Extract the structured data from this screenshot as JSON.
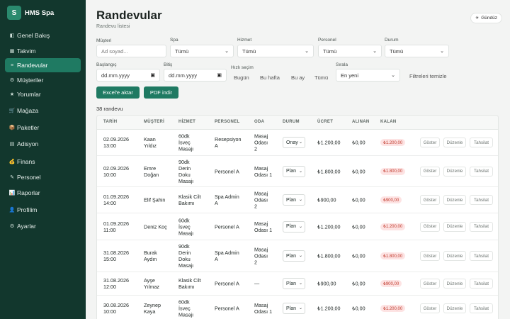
{
  "brand": {
    "logo_letter": "S",
    "name": "HMS Spa"
  },
  "sidebar": {
    "items": [
      {
        "label": "Genel Bakış",
        "icon": "dashboard-icon",
        "glyph": "◧"
      },
      {
        "label": "Takvim",
        "icon": "calendar-icon",
        "glyph": "▦"
      },
      {
        "label": "Randevular",
        "icon": "list-icon",
        "glyph": "≡",
        "active": true
      },
      {
        "label": "Müşteriler",
        "icon": "customers-icon",
        "glyph": "⚙"
      },
      {
        "label": "Yorumlar",
        "icon": "star-icon",
        "glyph": "★"
      },
      {
        "label": "Mağaza",
        "icon": "cart-icon",
        "glyph": "🛒"
      },
      {
        "label": "Paketler",
        "icon": "package-icon",
        "glyph": "📦"
      },
      {
        "label": "Adisyon",
        "icon": "receipt-icon",
        "glyph": "▤"
      },
      {
        "label": "Finans",
        "icon": "money-icon",
        "glyph": "💰"
      },
      {
        "label": "Personel",
        "icon": "staff-icon",
        "glyph": "✎"
      },
      {
        "label": "Raporlar",
        "icon": "chart-icon",
        "glyph": "📊"
      },
      {
        "label": "Profilim",
        "icon": "profile-icon",
        "glyph": "👤"
      },
      {
        "label": "Ayarlar",
        "icon": "settings-icon",
        "glyph": "⚙"
      }
    ]
  },
  "header": {
    "title": "Randevular",
    "subtitle": "Randevu listesi",
    "theme_label": "Gündüz",
    "theme_glyph": "☀"
  },
  "filters": {
    "customer_label": "Müşteri",
    "customer_placeholder": "Ad soyad...",
    "spa_label": "Spa",
    "spa_value": "Tümü",
    "service_label": "Hizmet",
    "service_value": "Tümü",
    "staff_label": "Personel",
    "staff_value": "Tümü",
    "status_label": "Durum",
    "status_value": "Tümü",
    "start_label": "Başlangıç",
    "start_placeholder": "dd.mm.yyyy",
    "end_label": "Bitiş",
    "end_placeholder": "dd.mm.yyyy",
    "quick_label": "Hızlı seçim",
    "quick_options": [
      "Bugün",
      "Bu hafta",
      "Bu ay",
      "Tümü"
    ],
    "sort_label": "Sırala",
    "sort_value": "En yeni",
    "clear_label": "Filtreleri temizle"
  },
  "actions": {
    "excel_label": "Excel'e aktar",
    "pdf_label": "PDF indir"
  },
  "count_text": "38 randevu",
  "table": {
    "columns": [
      "TARİH",
      "MÜŞTERİ",
      "HİZMET",
      "PERSONEL",
      "ODA",
      "DURUM",
      "ÜCRET",
      "ALINAN",
      "KALAN"
    ],
    "action_labels": {
      "show": "Göster",
      "edit": "Düzenle",
      "collect": "Tahsilat"
    },
    "rows": [
      {
        "date": [
          "02.09.2026",
          "13:00"
        ],
        "customer": [
          "Kaan",
          "Yıldız"
        ],
        "service": [
          "60dk",
          "İsveç",
          "Masajı"
        ],
        "staff": [
          "Resepsiyon",
          "A"
        ],
        "room": [
          "Masaj",
          "Odası",
          "2"
        ],
        "status": "Onay",
        "fee": "₺1.200,00",
        "paid": "₺0,00",
        "remaining": "₺1.200,00"
      },
      {
        "date": [
          "02.09.2026",
          "10:00"
        ],
        "customer": [
          "Emre",
          "Doğan"
        ],
        "service": [
          "90dk",
          "Derin",
          "Doku",
          "Masajı"
        ],
        "staff": [
          "Personel A"
        ],
        "room": [
          "Masaj",
          "Odası 1"
        ],
        "status": "Plan",
        "fee": "₺1.800,00",
        "paid": "₺0,00",
        "remaining": "₺1.800,00"
      },
      {
        "date": [
          "01.09.2026",
          "14:00"
        ],
        "customer": [
          "Elif Şahin"
        ],
        "service": [
          "Klasik Cilt",
          "Bakımı"
        ],
        "staff": [
          "Spa Admin",
          "A"
        ],
        "room": [
          "Masaj",
          "Odası",
          "2"
        ],
        "status": "Plan",
        "fee": "₺900,00",
        "paid": "₺0,00",
        "remaining": "₺900,00"
      },
      {
        "date": [
          "01.09.2026",
          "11:00"
        ],
        "customer": [
          "Deniz Koç"
        ],
        "service": [
          "60dk",
          "İsveç",
          "Masajı"
        ],
        "staff": [
          "Personel A"
        ],
        "room": [
          "Masaj",
          "Odası 1"
        ],
        "status": "Plan",
        "fee": "₺1.200,00",
        "paid": "₺0,00",
        "remaining": "₺1.200,00"
      },
      {
        "date": [
          "31.08.2026",
          "15:00"
        ],
        "customer": [
          "Burak",
          "Aydın"
        ],
        "service": [
          "90dk",
          "Derin",
          "Doku",
          "Masajı"
        ],
        "staff": [
          "Spa Admin",
          "A"
        ],
        "room": [
          "Masaj",
          "Odası",
          "2"
        ],
        "status": "Plan",
        "fee": "₺1.800,00",
        "paid": "₺0,00",
        "remaining": "₺1.800,00"
      },
      {
        "date": [
          "31.08.2026",
          "12:00"
        ],
        "customer": [
          "Ayşe",
          "Yılmaz"
        ],
        "service": [
          "Klasik Cilt",
          "Bakımı"
        ],
        "staff": [
          "Personel A"
        ],
        "room": [
          "—"
        ],
        "status": "Plan",
        "fee": "₺900,00",
        "paid": "₺0,00",
        "remaining": "₺900,00"
      },
      {
        "date": [
          "30.08.2026",
          "10:00"
        ],
        "customer": [
          "Zeynep",
          "Kaya"
        ],
        "service": [
          "60dk",
          "İsveç",
          "Masajı"
        ],
        "staff": [
          "Personel A"
        ],
        "room": [
          "Masaj",
          "Odası 1"
        ],
        "status": "Plan",
        "fee": "₺1.200,00",
        "paid": "₺0,00",
        "remaining": "₺1.200,00"
      }
    ]
  },
  "colors": {
    "sidebar_bg": "#12372d",
    "accent": "#1f7a62",
    "badge_bg": "#fde3e3",
    "badge_text": "#c0392b"
  }
}
